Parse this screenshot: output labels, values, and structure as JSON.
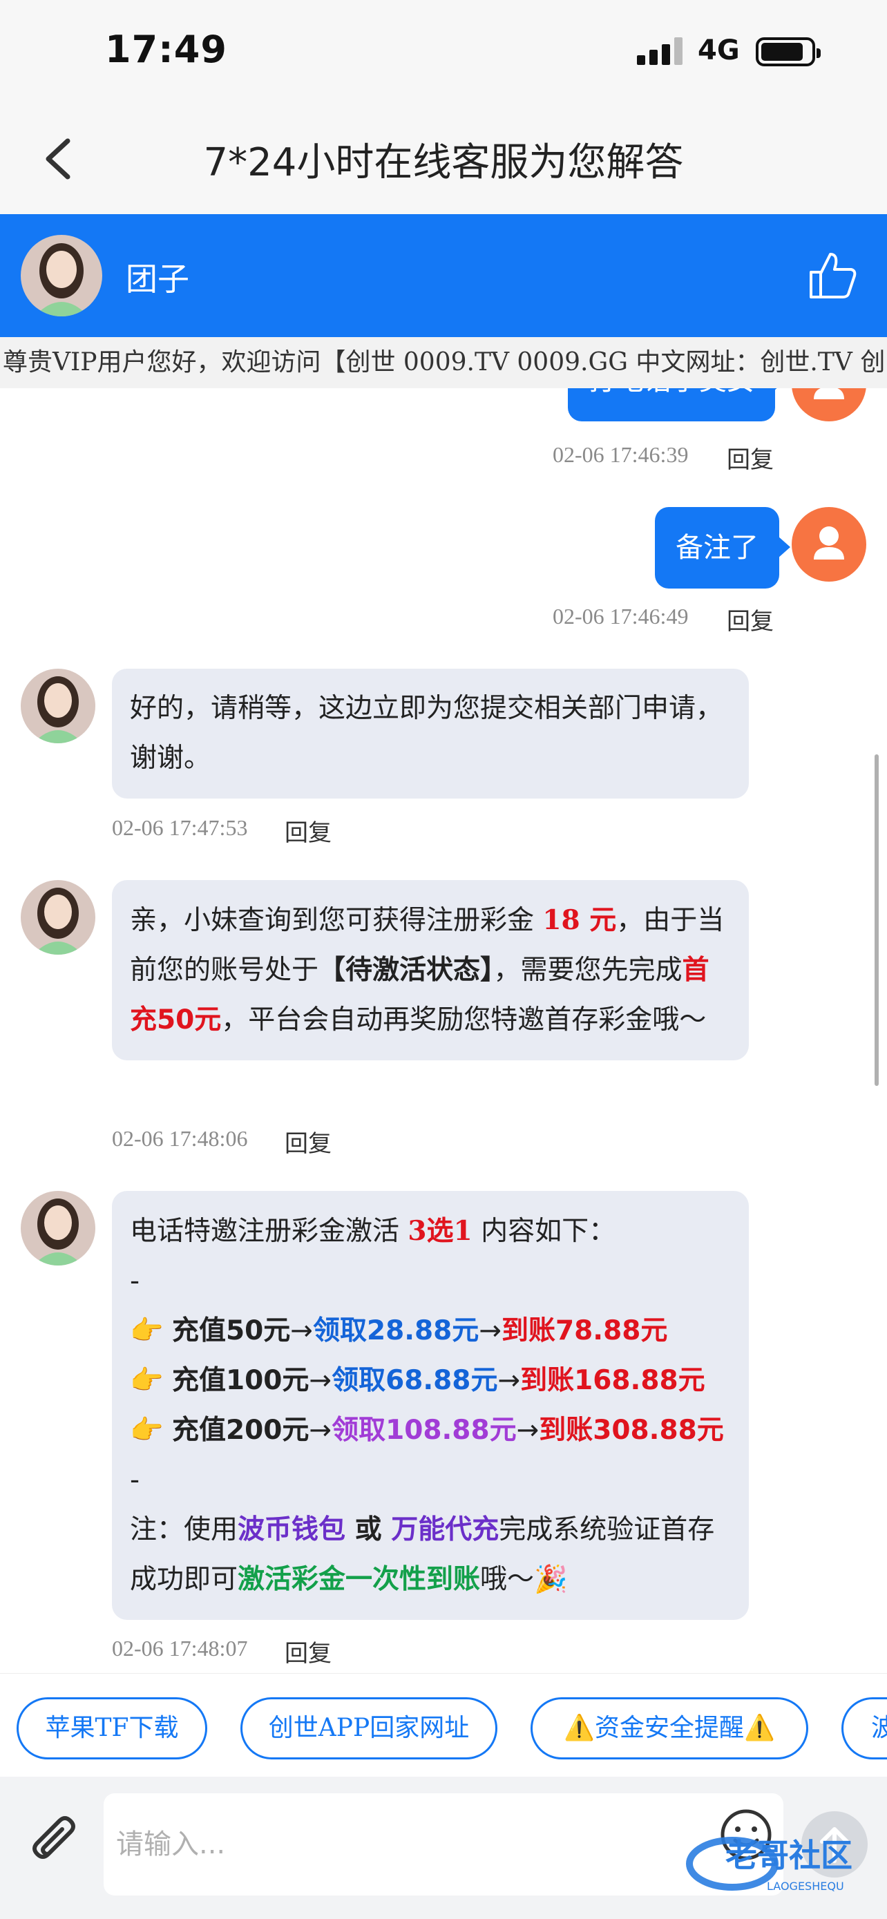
{
  "status": {
    "time": "17:49",
    "network": "4G"
  },
  "nav": {
    "title": "7*24小时在线客服为您解答"
  },
  "agent": {
    "name": "团子"
  },
  "marquee": {
    "text": "尊贵VIP用户您好，欢迎访问【创世 0009.TV 0009.GG 中文网址：创世.TV 创"
  },
  "messages": {
    "m1": {
      "text": "打电话了美女",
      "time": "02-06 17:46:39",
      "reply": "回复"
    },
    "m2": {
      "text": "备注了",
      "time": "02-06 17:46:49",
      "reply": "回复"
    },
    "m3": {
      "text": "好的，请稍等，这边立即为您提交相关部门申请，谢谢。",
      "time": "02-06 17:47:53",
      "reply": "回复"
    },
    "m4": {
      "t1": "亲，小妹查询到您可获得注册彩金 ",
      "amount": "18 元",
      "t2": "，由于当前您的账号处于",
      "status": "【待激活状态】",
      "t3": "，需要您先完成",
      "first": "首充50元",
      "t4": "，平台会自动再奖励您特邀首存彩金哦～",
      "time": "02-06 17:48:06",
      "reply": "回复"
    },
    "m5": {
      "intro": "电话特邀注册彩金激活 ",
      "choice": "3选1",
      "intro2": " 内容如下：",
      "dash": "-",
      "pointer": "👉",
      "arrow": "→",
      "lines": [
        {
          "deposit": "充值50元",
          "bonus": "领取28.88元",
          "total": "到账78.88元"
        },
        {
          "deposit": "充值100元",
          "bonus": "领取68.88元",
          "total": "到账168.88元"
        },
        {
          "deposit": "充值200元",
          "bonus": "领取108.88元",
          "total": "到账308.88元"
        }
      ],
      "note1": "注：使用",
      "wallet": "波币钱包",
      "or": " 或 ",
      "agent_pay": "万能代充",
      "note2": "完成系统验证首存成功即可",
      "activate": "激活彩金一次性到账",
      "note3": "哦～",
      "party": "🎉",
      "time": "02-06 17:48:07",
      "reply": "回复"
    }
  },
  "quick_links": [
    "苹果TF下载",
    "创世APP回家网址",
    "⚠️资金安全提醒⚠️",
    "波"
  ],
  "input": {
    "placeholder": "请输入..."
  },
  "watermark": {
    "text": "老哥社区",
    "sub": "LAOGESHEQU"
  },
  "colors": {
    "primary": "#1478f5",
    "bubble": "#e8ebf3",
    "user_avatar": "#f77442"
  }
}
